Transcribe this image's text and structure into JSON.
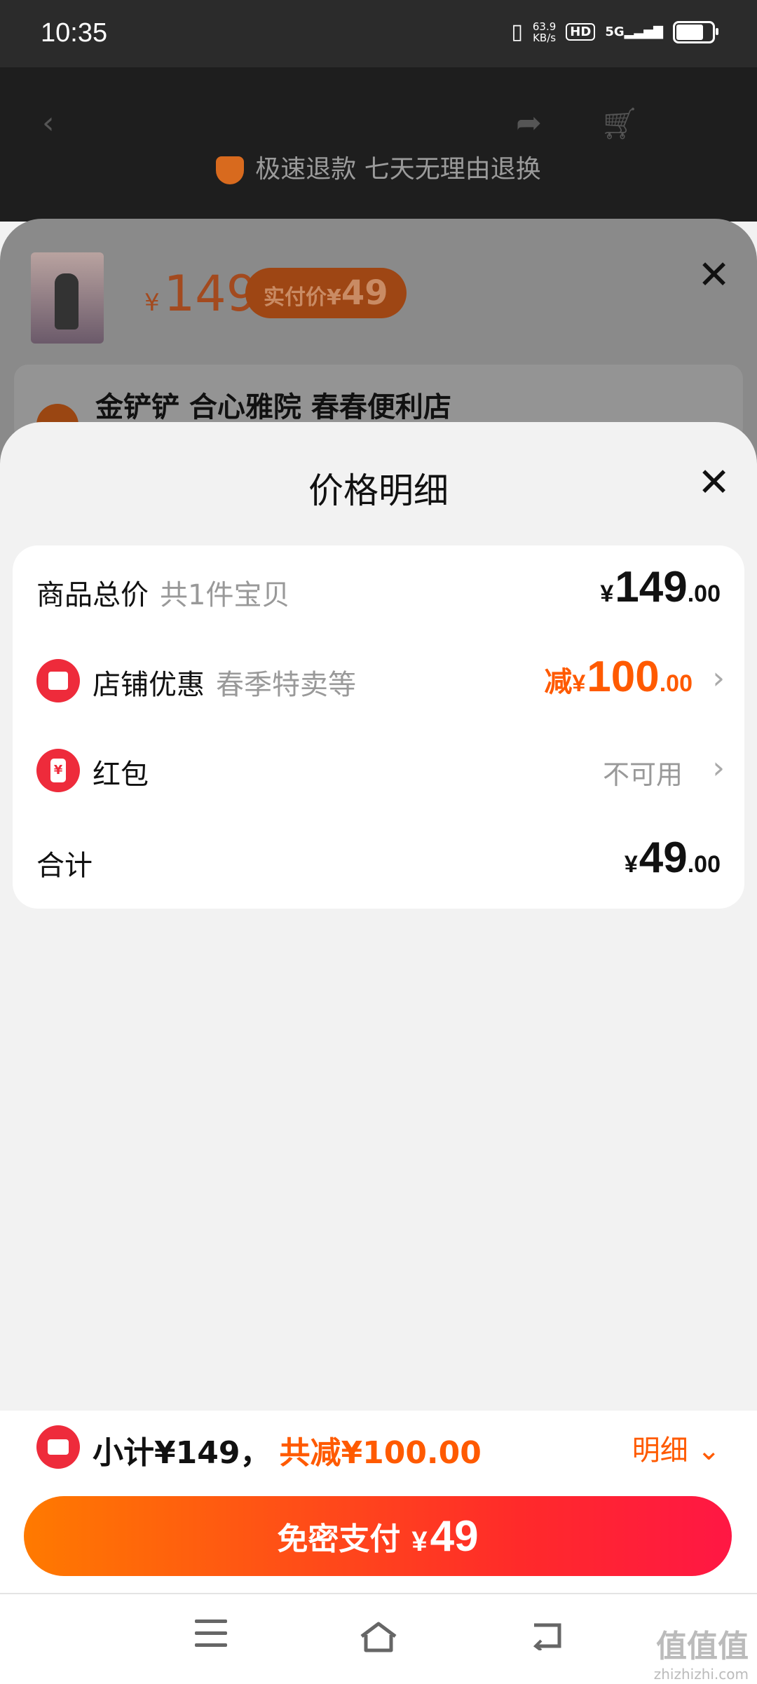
{
  "status_bar": {
    "time": "10:35",
    "net_speed_value": "63.9",
    "net_speed_unit": "KB/s",
    "hd": "HD",
    "network": "5G"
  },
  "background_page": {
    "guarantee_text": "极速退款 七天无理由退换",
    "sheet": {
      "price": "149",
      "yen": "¥",
      "pay_label": "实付价",
      "pay_yen": "¥",
      "pay_price": "49",
      "store_name": "金铲铲 合心雅院  春春便利店"
    }
  },
  "price_detail": {
    "title": "价格明细",
    "rows": [
      {
        "label": "商品总价",
        "sub": "共1件宝贝",
        "yen": "¥",
        "int": "149",
        "dec": ".00"
      },
      {
        "label": "店铺优惠",
        "sub": "春季特卖等",
        "prefix": "减",
        "yen": "¥",
        "int": "100",
        "dec": ".00"
      },
      {
        "label": "红包",
        "value": "不可用"
      },
      {
        "label": "合计",
        "yen": "¥",
        "int": "49",
        "dec": ".00"
      }
    ]
  },
  "bottom": {
    "subtotal": "小计¥149，",
    "discount": "共减¥100.00",
    "detail": "明细",
    "pay_label": "免密支付",
    "pay_yen": "¥",
    "pay_amount": "49"
  },
  "watermark": {
    "brand": "值值值",
    "url": "zhizhizhi.com"
  },
  "colors": {
    "accent_orange": "#ff5a00",
    "red_icon": "#ee2b3b"
  }
}
